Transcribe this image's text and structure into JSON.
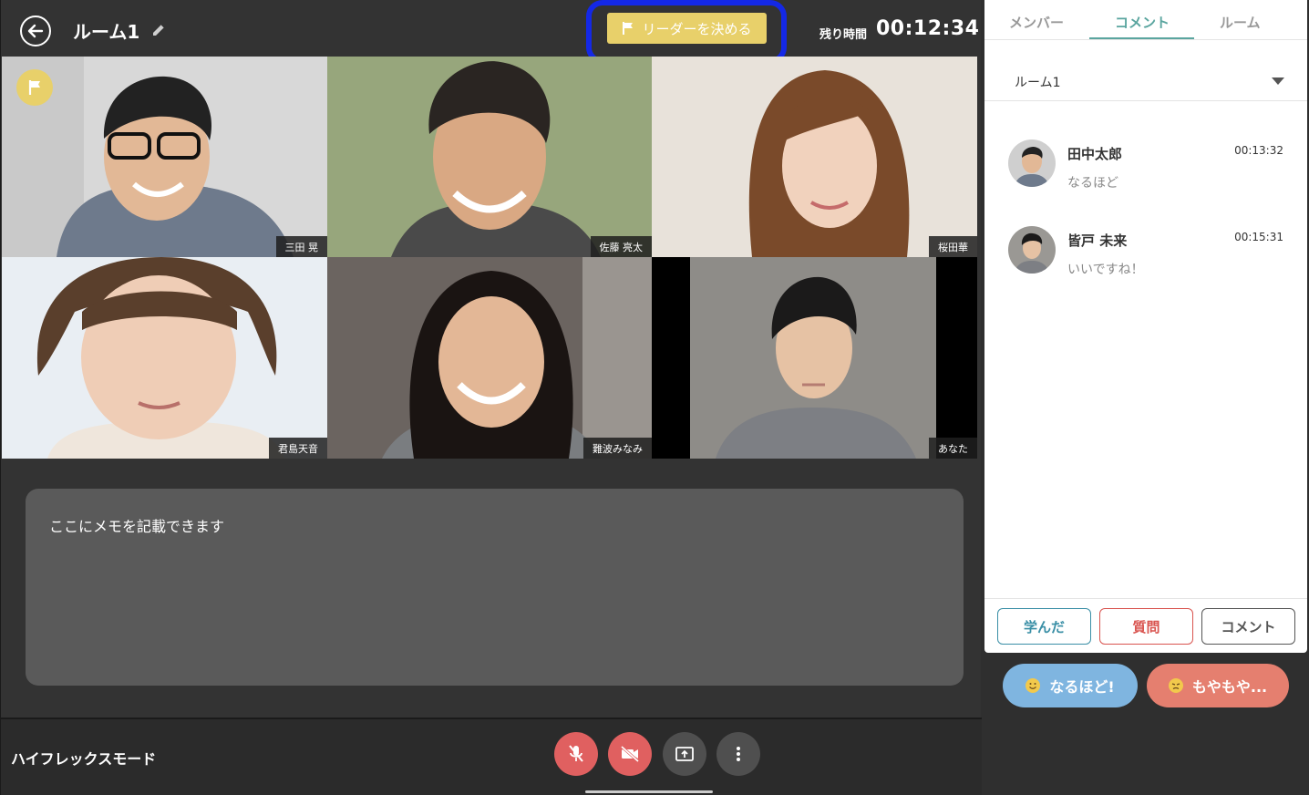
{
  "header": {
    "room_title": "ルーム1",
    "leader_button": "リーダーを決める",
    "remaining_label": "残り時間",
    "remaining_time": "00:12:34"
  },
  "participants": [
    {
      "name": "三田 晃",
      "leader": true
    },
    {
      "name": "佐藤 亮太",
      "leader": false
    },
    {
      "name": "桜田華",
      "leader": false
    },
    {
      "name": "君島天音",
      "leader": false
    },
    {
      "name": "難波みなみ",
      "leader": false
    },
    {
      "name": "あなた",
      "leader": false
    }
  ],
  "memo": {
    "placeholder": "ここにメモを記載できます"
  },
  "bottom": {
    "mode_label": "ハイフレックスモード"
  },
  "panel": {
    "tabs": [
      "メンバー",
      "コメント",
      "ルーム"
    ],
    "active_tab": "コメント",
    "room_select": "ルーム1",
    "comments": [
      {
        "name": "田中太郎",
        "time": "00:13:32",
        "text": "なるほど"
      },
      {
        "name": "皆戸 未来",
        "time": "00:15:31",
        "text": "いいですね！"
      }
    ],
    "actions": [
      {
        "label": "学んだ",
        "color": "#3a8fa6"
      },
      {
        "label": "質問",
        "color": "#d9544f"
      },
      {
        "label": "コメント",
        "color": "#555555"
      }
    ]
  },
  "reactions": [
    {
      "label": "なるほど!",
      "color": "#7fb5e0"
    },
    {
      "label": "もやもや...",
      "color": "#e57f6f"
    }
  ],
  "colors": {
    "accent": "#5aa59f",
    "leader": "#e8d06a",
    "highlight": "#1428e6"
  }
}
